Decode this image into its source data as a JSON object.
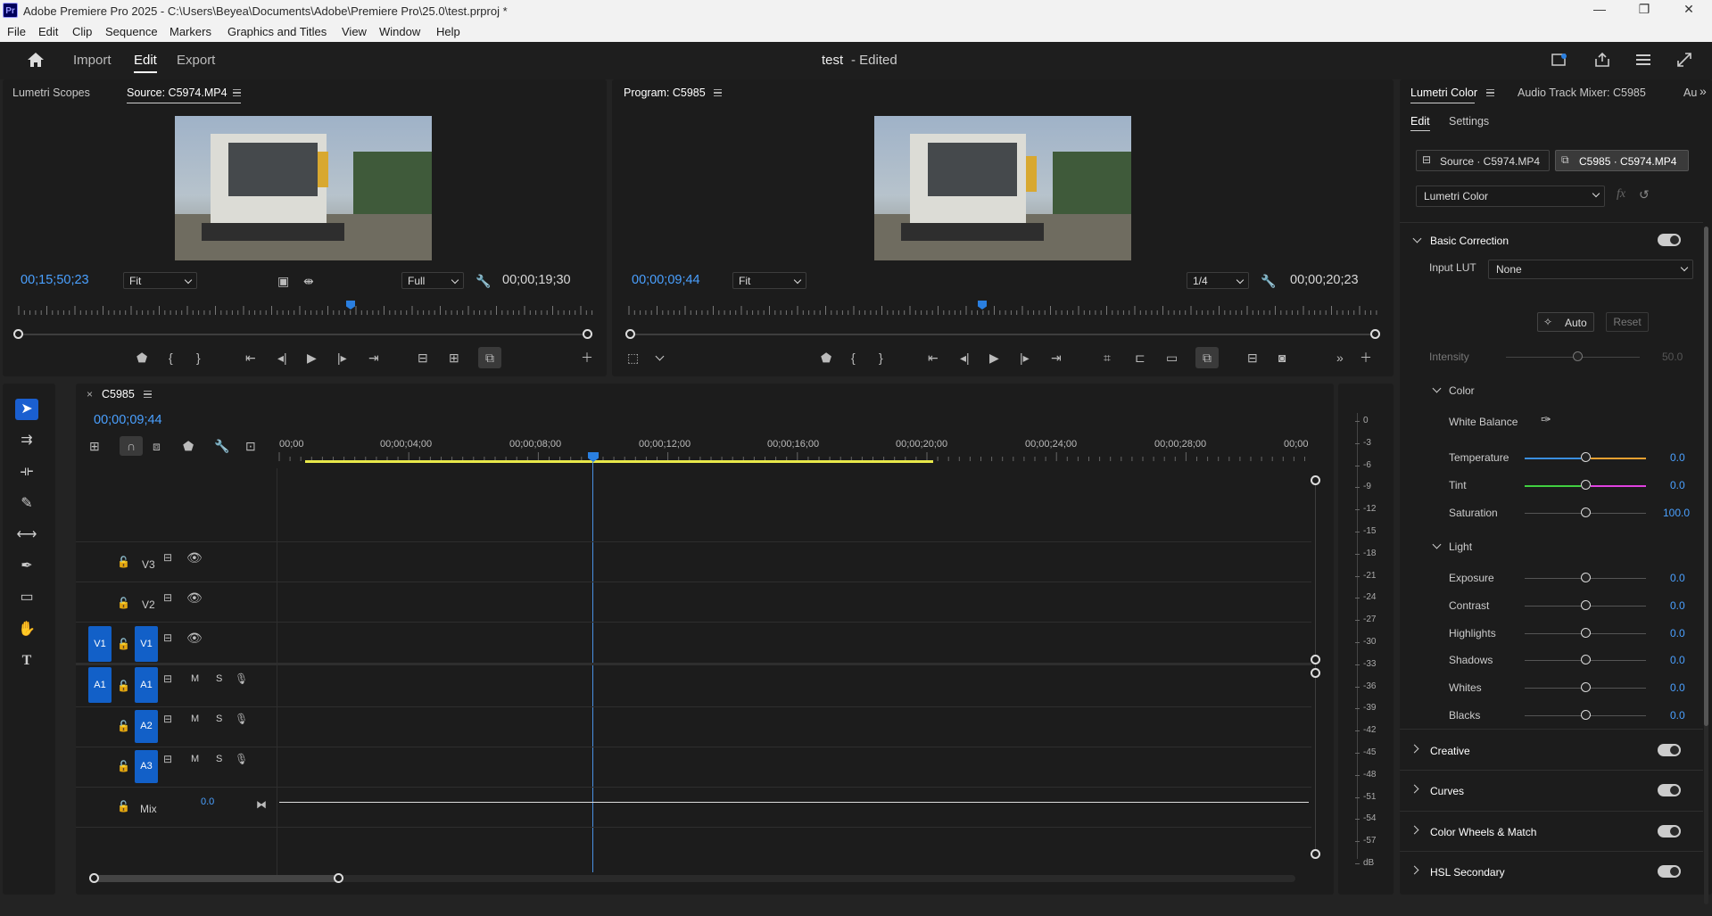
{
  "window": {
    "title": "Adobe Premiere Pro 2025 - C:\\Users\\Beyea\\Documents\\Adobe\\Premiere Pro\\25.0\\test.prproj *",
    "logo": "Pr"
  },
  "menu": [
    "File",
    "Edit",
    "Clip",
    "Sequence",
    "Markers",
    "Graphics and Titles",
    "View",
    "Window",
    "Help"
  ],
  "header": {
    "tabs": [
      "Import",
      "Edit",
      "Export"
    ],
    "active_tab": "Edit",
    "project_title": "test",
    "project_status": "- Edited"
  },
  "source": {
    "tab_scopes": "Lumetri Scopes",
    "tab_source": "Source: C5974.MP4",
    "timecode": "00;15;50;23",
    "zoom": "Fit",
    "quality": "Full",
    "duration": "00;00;19;30"
  },
  "program": {
    "tab": "Program: C5985",
    "timecode": "00;00;09;44",
    "zoom": "Fit",
    "quality": "1/4",
    "duration": "00;00;20;23"
  },
  "timeline": {
    "tab": "C5985",
    "timecode": "00;00;09;44",
    "ruler": [
      "00;00",
      "00;00;04;00",
      "00;00;08;00",
      "00;00;12;00",
      "00;00;16;00",
      "00;00;20;00",
      "00;00;24;00",
      "00;00;28;00",
      "00;00"
    ],
    "video_tracks": [
      {
        "name": "V3",
        "src": ""
      },
      {
        "name": "V2",
        "src": ""
      },
      {
        "name": "V1",
        "src": "V1"
      }
    ],
    "audio_tracks": [
      {
        "name": "A1",
        "src": "A1"
      },
      {
        "name": "A2",
        "src": ""
      },
      {
        "name": "A3",
        "src": ""
      }
    ],
    "mute": "M",
    "solo": "S",
    "mix_label": "Mix",
    "mix_value": "0.0"
  },
  "meter": {
    "ticks": [
      "0",
      "-3",
      "-6",
      "-9",
      "-12",
      "-15",
      "-18",
      "-21",
      "-24",
      "-27",
      "-30",
      "-33",
      "-36",
      "-39",
      "-42",
      "-45",
      "-48",
      "-51",
      "-54",
      "-57",
      "dB"
    ]
  },
  "lumetri": {
    "tab": "Lumetri Color",
    "tab2": "Audio Track Mixer: C5985",
    "tab3": "Au",
    "subtabs": [
      "Edit",
      "Settings"
    ],
    "clip_source": "Source · C5974.MP4",
    "clip_seq": "C5985 · C5974.MP4",
    "effect": "Lumetri Color",
    "basic": "Basic Correction",
    "input_lut_label": "Input LUT",
    "input_lut": "None",
    "auto": "Auto",
    "reset": "Reset",
    "intensity_label": "Intensity",
    "intensity": "50.0",
    "color": "Color",
    "white_balance": "White Balance",
    "color_params": [
      {
        "label": "Temperature",
        "value": "0.0"
      },
      {
        "label": "Tint",
        "value": "0.0"
      },
      {
        "label": "Saturation",
        "value": "100.0"
      }
    ],
    "light": "Light",
    "light_params": [
      {
        "label": "Exposure",
        "value": "0.0"
      },
      {
        "label": "Contrast",
        "value": "0.0"
      },
      {
        "label": "Highlights",
        "value": "0.0"
      },
      {
        "label": "Shadows",
        "value": "0.0"
      },
      {
        "label": "Whites",
        "value": "0.0"
      },
      {
        "label": "Blacks",
        "value": "0.0"
      }
    ],
    "sections": [
      "Creative",
      "Curves",
      "Color Wheels & Match",
      "HSL Secondary"
    ]
  },
  "colors": {
    "accent": "#4aa0ff",
    "track_blue": "#1260c8",
    "playhead": "#2a7fe0",
    "work_area": "#e8e84a"
  }
}
